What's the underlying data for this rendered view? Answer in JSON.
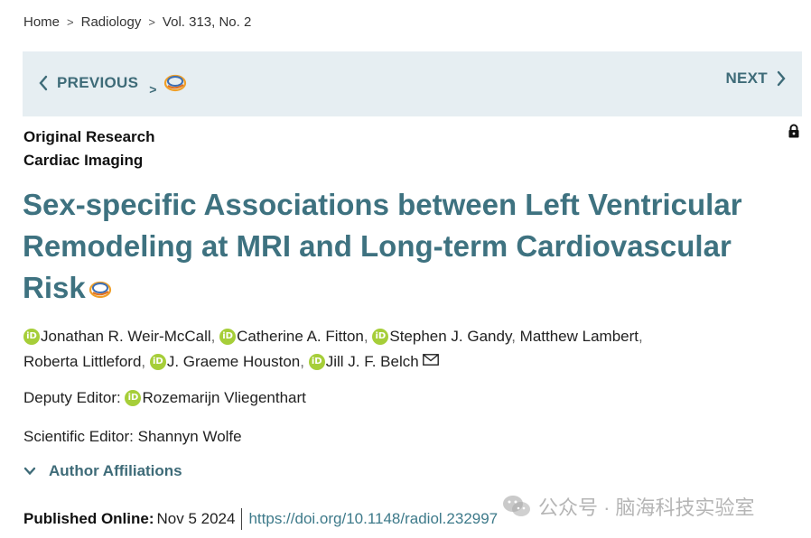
{
  "breadcrumb": {
    "items": [
      "Home",
      "Radiology",
      "Vol. 313, No. 2"
    ],
    "separator": ">"
  },
  "nav": {
    "previous_label": "PREVIOUS",
    "small_arrow": ">",
    "next_label": "NEXT"
  },
  "article": {
    "category1": "Original Research",
    "category2": "Cardiac Imaging",
    "title": "Sex-specific Associations between Left Ventricular Remodeling at MRI and Long-term Cardiovascular Risk"
  },
  "authors": [
    {
      "name": "Jonathan R. Weir-McCall",
      "orcid": true
    },
    {
      "name": "Catherine A. Fitton",
      "orcid": true
    },
    {
      "name": "Stephen J. Gandy",
      "orcid": true
    },
    {
      "name": "Matthew Lambert",
      "orcid": false
    },
    {
      "name": "Roberta Littleford",
      "orcid": false
    },
    {
      "name": "J. Graeme Houston",
      "orcid": true
    },
    {
      "name": "Jill J. F. Belch",
      "orcid": true,
      "corresponding": true
    }
  ],
  "editors": {
    "deputy_label": "Deputy Editor:",
    "deputy_name": "Rozemarijn Vliegenthart",
    "scientific_label": "Scientific Editor:",
    "scientific_name": "Shannyn Wolfe"
  },
  "affiliations_label": "Author Affiliations",
  "published": {
    "label": "Published Online:",
    "date": "Nov 5 2024",
    "doi": "https://doi.org/10.1148/radiol.232997"
  },
  "watermark": {
    "text": "公众号 · 脑海科技实验室"
  },
  "icons": {
    "orcid": "orcid-icon",
    "lock": "lock-icon",
    "mail": "mail-icon",
    "logo": "journal-logo-icon"
  },
  "colors": {
    "nav_bg": "#e6eef2",
    "accent": "#3e7280",
    "orcid": "#a6ce39"
  }
}
